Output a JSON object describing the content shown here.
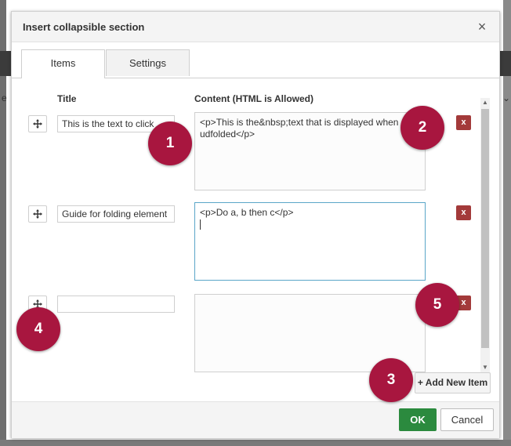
{
  "dialog": {
    "title": "Insert collapsible section",
    "close_glyph": "×"
  },
  "tabs": [
    {
      "label": "Items",
      "active": true
    },
    {
      "label": "Settings",
      "active": false
    }
  ],
  "columns": {
    "title": "Title",
    "content": "Content (HTML is Allowed)"
  },
  "items": [
    {
      "title": "This is the text to click",
      "content": "<p>This is the&nbsp;text that is displayed when udfolded</p>",
      "delete_label": "x"
    },
    {
      "title": "Guide for folding element",
      "content": "<p>Do a, b then c</p>",
      "delete_label": "x"
    },
    {
      "title": "",
      "content": "",
      "delete_label": "x"
    }
  ],
  "add_item_label": "+ Add New Item",
  "footer": {
    "ok_label": "OK",
    "cancel_label": "Cancel"
  },
  "markers": [
    "1",
    "2",
    "3",
    "4",
    "5"
  ],
  "colors": {
    "marker": "#a8163f",
    "ok": "#2b8a3e",
    "delete": "#a33a3a",
    "focus_border": "#5aa6c8"
  },
  "icons": {
    "drag_handle": "move-icon",
    "scroll_up": "arrow-up-icon",
    "scroll_down": "arrow-down-icon"
  }
}
